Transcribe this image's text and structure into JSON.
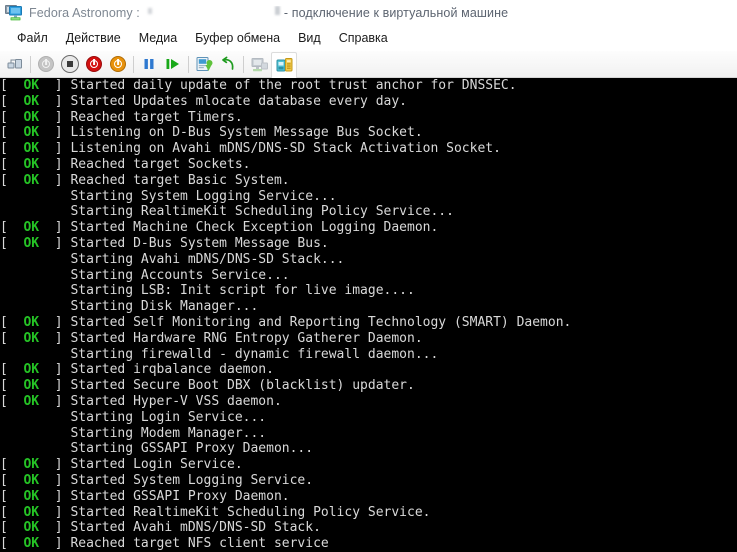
{
  "window": {
    "icon": "virtual-machine-monitor-icon",
    "title_prefix": "Fedora Astronomy :",
    "title_redacted": "",
    "title_suffix": "- подключение к виртуальной машине"
  },
  "menubar": {
    "items": [
      {
        "label": "Файл",
        "name": "menu-file"
      },
      {
        "label": "Действие",
        "name": "menu-action"
      },
      {
        "label": "Медиа",
        "name": "menu-media"
      },
      {
        "label": "Буфер обмена",
        "name": "menu-clipboard"
      },
      {
        "label": "Вид",
        "name": "menu-view"
      },
      {
        "label": "Справка",
        "name": "menu-help"
      }
    ]
  },
  "toolbar": {
    "buttons": [
      {
        "name": "checkpoints-icon",
        "tip": "Контрольные точки"
      },
      {
        "name": "power-off-icon",
        "tip": "Выключить"
      },
      {
        "name": "shutdown-icon",
        "tip": "Завершение работы"
      },
      {
        "name": "turn-off-icon",
        "tip": "Выключить"
      },
      {
        "name": "start-power-icon",
        "tip": "Пуск"
      },
      {
        "name": "pause-icon",
        "tip": "Пауза"
      },
      {
        "name": "resume-icon",
        "tip": "Возобновить"
      },
      {
        "name": "snapshot-icon",
        "tip": "Создать контрольную точку"
      },
      {
        "name": "revert-icon",
        "tip": "Откат"
      },
      {
        "name": "basic-session-icon",
        "tip": "Основной сеанс"
      },
      {
        "name": "enhanced-session-icon",
        "tip": "Расширенный сеанс"
      }
    ],
    "colors": {
      "power_red": "#d21010",
      "power_orange": "#e8920c",
      "power_grey": "#b9b9b9",
      "play_green": "#18a818",
      "pause_blue": "#2f79d0"
    }
  },
  "terminal": {
    "background": "#000000",
    "text_color": "#d9d9d9",
    "ok_color": "#25c325",
    "lines": [
      {
        "status": "OK",
        "text": "Started daily update of the root trust anchor for DNSSEC."
      },
      {
        "status": "OK",
        "text": "Started Updates mlocate database every day."
      },
      {
        "status": "OK",
        "text": "Reached target Timers."
      },
      {
        "status": "OK",
        "text": "Listening on D-Bus System Message Bus Socket."
      },
      {
        "status": "OK",
        "text": "Listening on Avahi mDNS/DNS-SD Stack Activation Socket."
      },
      {
        "status": "OK",
        "text": "Reached target Sockets."
      },
      {
        "status": "OK",
        "text": "Reached target Basic System."
      },
      {
        "status": "",
        "text": "Starting System Logging Service..."
      },
      {
        "status": "",
        "text": "Starting RealtimeKit Scheduling Policy Service..."
      },
      {
        "status": "OK",
        "text": "Started Machine Check Exception Logging Daemon."
      },
      {
        "status": "OK",
        "text": "Started D-Bus System Message Bus."
      },
      {
        "status": "",
        "text": "Starting Avahi mDNS/DNS-SD Stack..."
      },
      {
        "status": "",
        "text": "Starting Accounts Service..."
      },
      {
        "status": "",
        "text": "Starting LSB: Init script for live image...."
      },
      {
        "status": "",
        "text": "Starting Disk Manager..."
      },
      {
        "status": "OK",
        "text": "Started Self Monitoring and Reporting Technology (SMART) Daemon."
      },
      {
        "status": "OK",
        "text": "Started Hardware RNG Entropy Gatherer Daemon."
      },
      {
        "status": "",
        "text": "Starting firewalld - dynamic firewall daemon..."
      },
      {
        "status": "OK",
        "text": "Started irqbalance daemon."
      },
      {
        "status": "OK",
        "text": "Started Secure Boot DBX (blacklist) updater."
      },
      {
        "status": "OK",
        "text": "Started Hyper-V VSS daemon."
      },
      {
        "status": "",
        "text": "Starting Login Service..."
      },
      {
        "status": "",
        "text": "Starting Modem Manager..."
      },
      {
        "status": "",
        "text": "Starting GSSAPI Proxy Daemon..."
      },
      {
        "status": "OK",
        "text": "Started Login Service."
      },
      {
        "status": "OK",
        "text": "Started System Logging Service."
      },
      {
        "status": "OK",
        "text": "Started GSSAPI Proxy Daemon."
      },
      {
        "status": "OK",
        "text": "Started RealtimeKit Scheduling Policy Service."
      },
      {
        "status": "OK",
        "text": "Started Avahi mDNS/DNS-SD Stack."
      },
      {
        "status": "OK",
        "text": "Reached target NFS client service"
      }
    ]
  }
}
